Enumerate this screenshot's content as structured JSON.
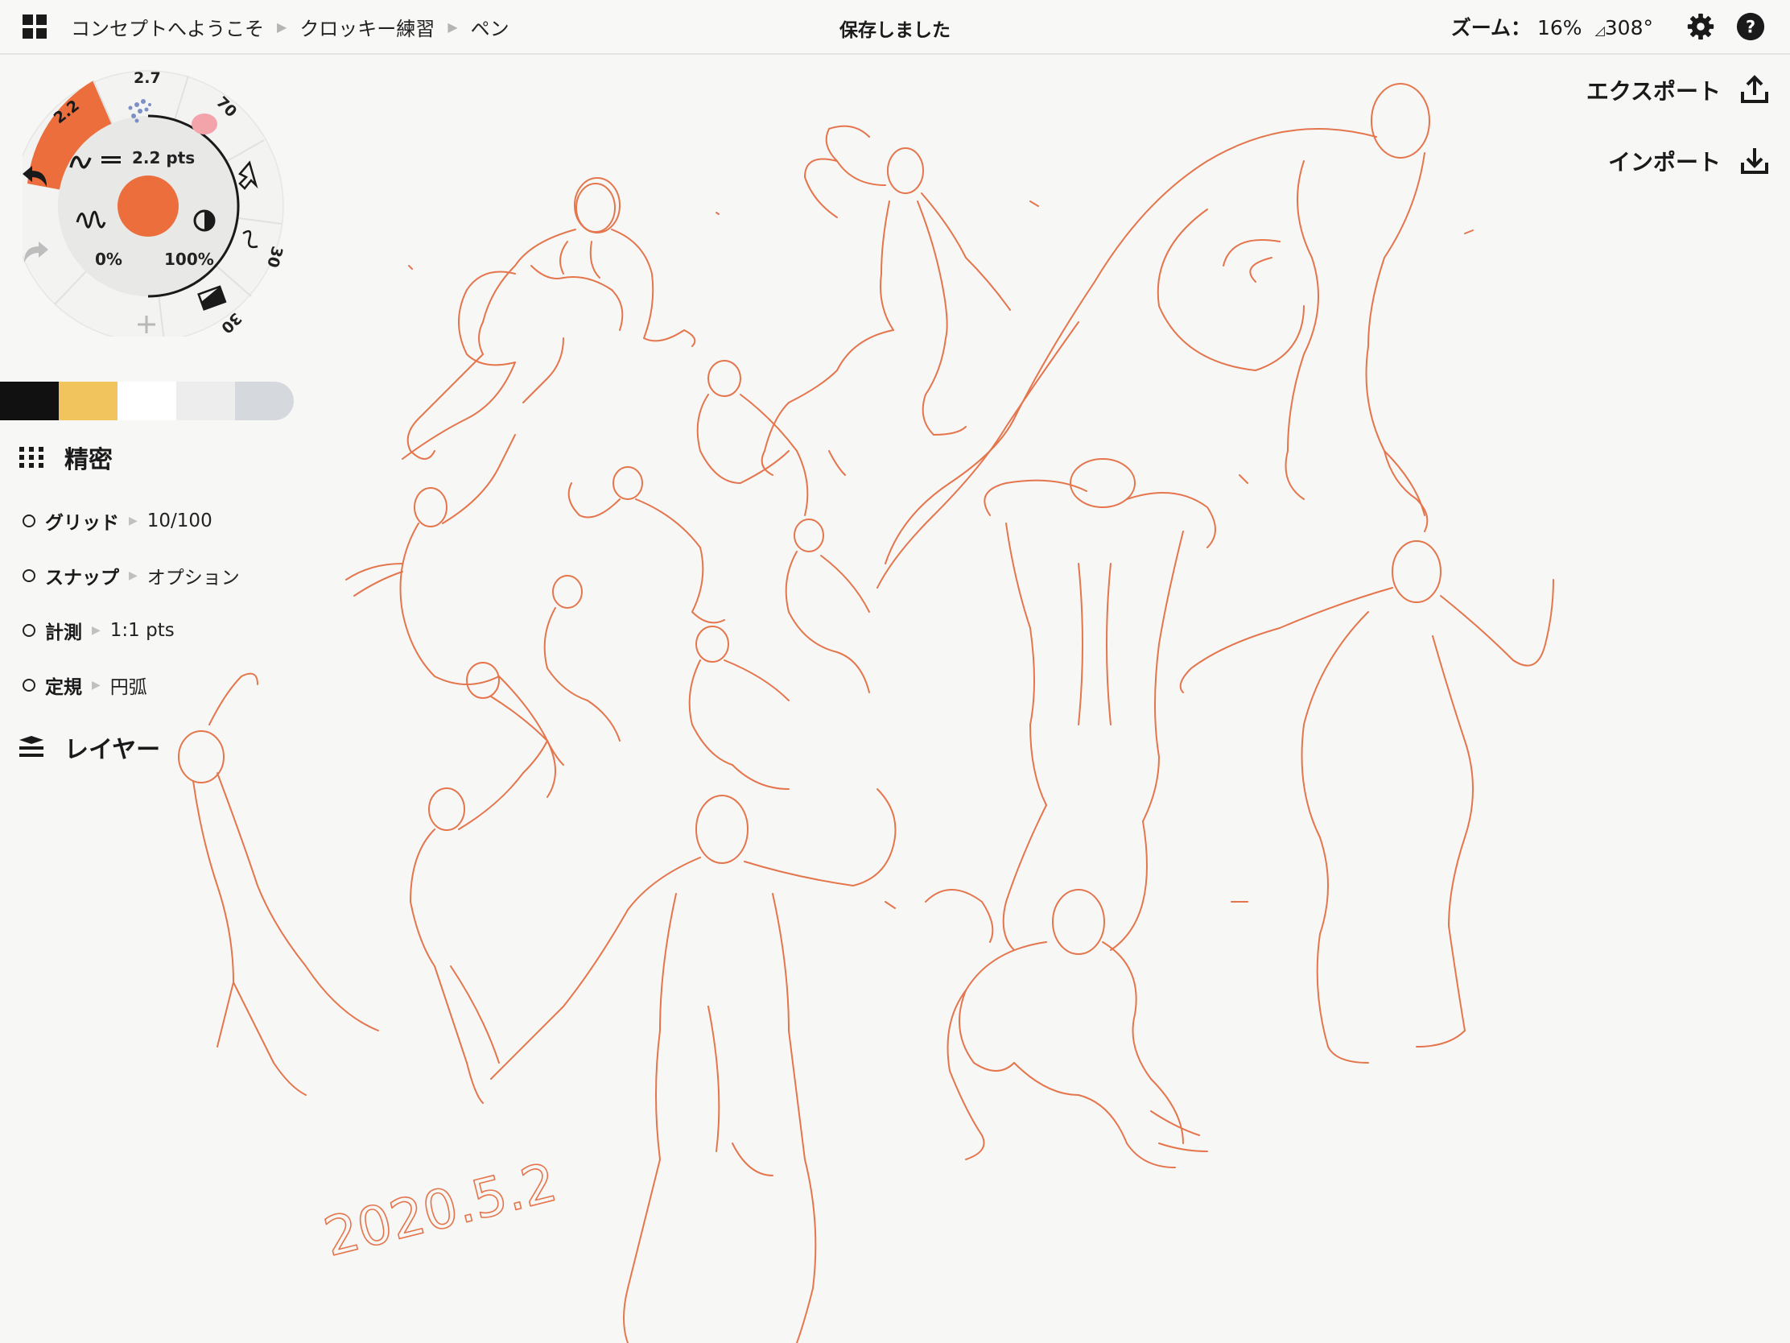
{
  "topbar": {
    "breadcrumbs": [
      "コンセプトへようこそ",
      "クロッキー練習",
      "ペン"
    ],
    "status": "保存しました",
    "zoom_label": "ズーム：",
    "zoom_value": "16%",
    "rotation_value": "308°"
  },
  "actions": {
    "export_label": "エクスポート",
    "import_label": "インポート"
  },
  "tool_wheel": {
    "active_tool_size": "2.2",
    "pencil_size": "2.7",
    "marker_size": "70",
    "brush_size": "30",
    "eraser_size": "30",
    "stroke_weight": "2.2 pts",
    "smoothing": "0%",
    "opacity": "100%",
    "active_color": "#ec6e3c"
  },
  "palette": {
    "colors": [
      "#111111",
      "#f2c45d",
      "#ffffff",
      "#ededed",
      "#d5d9dd"
    ]
  },
  "precision": {
    "title": "精密",
    "options": [
      {
        "name": "グリッド",
        "value": "10/100"
      },
      {
        "name": "スナップ",
        "value": "オプション"
      },
      {
        "name": "計測",
        "value": "1:1 pts"
      },
      {
        "name": "定規",
        "value": "円弧"
      }
    ]
  },
  "layers": {
    "title": "レイヤー"
  },
  "canvas": {
    "sketch_color": "#e3683a",
    "date_text": "2020.5.2"
  }
}
